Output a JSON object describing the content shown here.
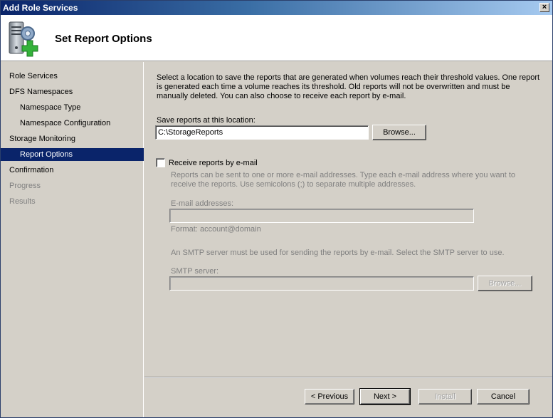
{
  "window": {
    "title": "Add Role Services",
    "close_glyph": "×"
  },
  "header": {
    "title": "Set Report Options",
    "icon": "server-add-icon"
  },
  "sidebar": {
    "items": [
      {
        "label": "Role Services",
        "state": "normal"
      },
      {
        "label": "DFS Namespaces",
        "state": "normal"
      },
      {
        "label": "Namespace Type",
        "state": "normal"
      },
      {
        "label": "Namespace Configuration",
        "state": "normal"
      },
      {
        "label": "Storage Monitoring",
        "state": "normal"
      },
      {
        "label": "Report Options",
        "state": "selected"
      },
      {
        "label": "Confirmation",
        "state": "normal"
      },
      {
        "label": "Progress",
        "state": "disabled"
      },
      {
        "label": "Results",
        "state": "disabled"
      }
    ]
  },
  "main": {
    "description": "Select a location to save the reports that are generated when volumes reach their threshold values. One report is generated each time a volume reaches its threshold. Old reports will not be overwritten and must be manually deleted. You can also choose to receive each report by e-mail.",
    "save_location_label": "Save reports at this location:",
    "save_location_value": "C:\\StorageReports",
    "browse_label": "Browse...",
    "email_checkbox_label": "Receive reports by e-mail",
    "email_checkbox_checked": false,
    "email_desc": "Reports can be sent to one or more e-mail addresses. Type each e-mail address where you want to receive the reports. Use semicolons (;) to separate multiple addresses.",
    "email_addresses_label": "E-mail addresses:",
    "email_addresses_value": "",
    "format_hint": "Format: account@domain",
    "smtp_desc": "An SMTP server must be used for sending the reports by e-mail. Select the SMTP server to use.",
    "smtp_label": "SMTP server:",
    "smtp_value": "",
    "smtp_browse_label": "Browse..."
  },
  "footer": {
    "previous_label": "< Previous",
    "next_label": "Next >",
    "install_label": "Install",
    "cancel_label": "Cancel"
  },
  "colors": {
    "selection": "#0a246a",
    "dialog_bg": "#d4d0c8",
    "disabled_text": "#808080"
  }
}
